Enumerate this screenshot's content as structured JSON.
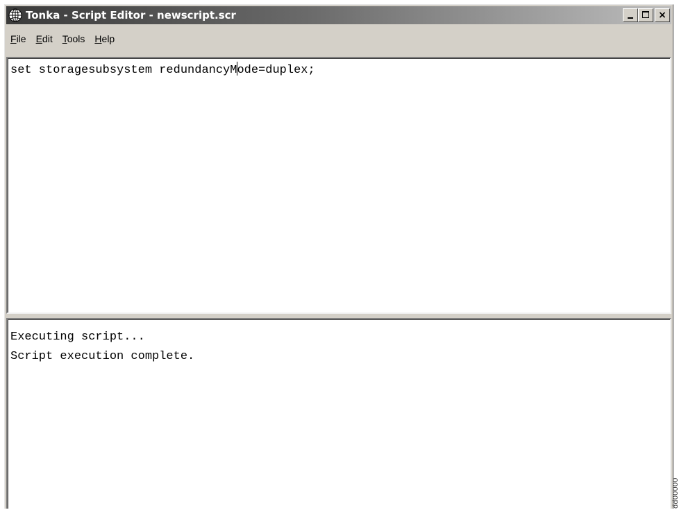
{
  "window": {
    "title": "Tonka - Script Editor - newscript.scr",
    "minimize_label": "_",
    "close_label": "×"
  },
  "menu": {
    "items": [
      {
        "accel": "F",
        "rest": "ile"
      },
      {
        "accel": "E",
        "rest": "dit"
      },
      {
        "accel": "T",
        "rest": "ools"
      },
      {
        "accel": "H",
        "rest": "elp"
      }
    ]
  },
  "editor": {
    "text_before_caret": "set storagesubsystem redundancyM",
    "text_after_caret": "ode=duplex;"
  },
  "output": {
    "lines": [
      "Executing script...",
      "Script execution complete."
    ]
  },
  "side_label": "dd00000",
  "colors": {
    "titlebar_start": "#3a3a3a",
    "titlebar_end": "#bdbdbd",
    "chrome": "#d4d0c8",
    "pane_bg": "#ffffff"
  },
  "icons": {
    "app": "globe-icon",
    "minimize": "minimize-icon",
    "maximize": "maximize-icon",
    "close": "close-icon"
  }
}
